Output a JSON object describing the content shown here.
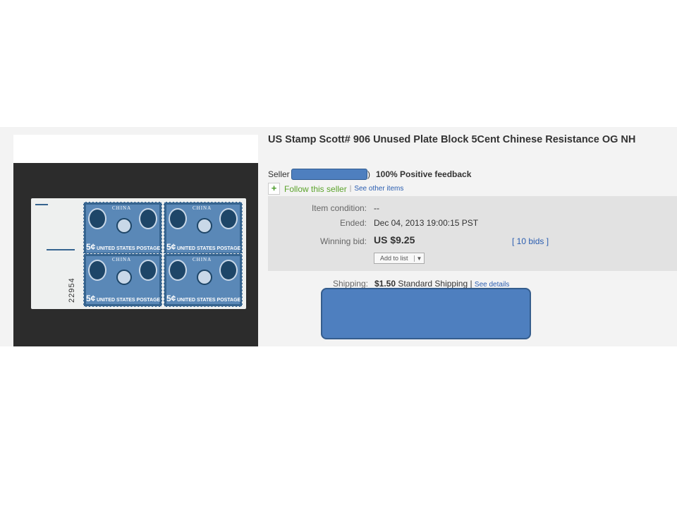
{
  "listing": {
    "title": "US Stamp Scott# 906 Unused Plate Block 5Cent Chinese Resistance OG NH"
  },
  "stamp_image": {
    "plate_number": "22954",
    "stamp_caption": "UNITED STATES POSTAGE",
    "stamp_value": "5¢",
    "stamp_word": "CHINA"
  },
  "seller": {
    "label": "Seller :",
    "close_paren": ")",
    "feedback": "100% Positive feedback",
    "follow_label": "Follow this seller",
    "separator": "|",
    "other_items": "See other items"
  },
  "details": {
    "condition_label": "Item condition:",
    "condition_value": "--",
    "ended_label": "Ended:",
    "ended_value": "Dec 04, 2013  19:00:15 PST",
    "winning_label": "Winning bid:",
    "winning_value": "US $9.25",
    "bids_link": "[ 10 bids ]",
    "add_to_list": "Add to list"
  },
  "shipping": {
    "label": "Shipping:",
    "price": "$1.50",
    "method": "Standard Shipping |",
    "see_details": "See details"
  },
  "colors": {
    "redaction": "#4e7fbf",
    "link": "#2a5db0",
    "follow": "#5ba32b",
    "stamp_blue": "#36648f"
  }
}
